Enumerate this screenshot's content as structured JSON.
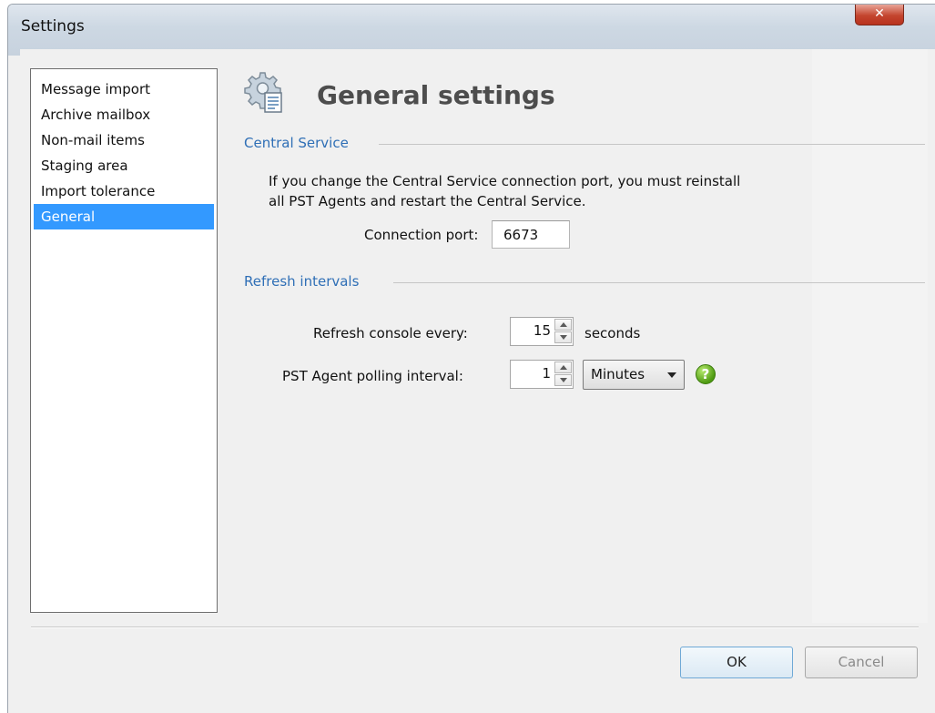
{
  "window": {
    "title": "Settings",
    "close_glyph": "✕"
  },
  "nav": {
    "items": [
      {
        "label": "Message import"
      },
      {
        "label": "Archive mailbox"
      },
      {
        "label": "Non-mail items"
      },
      {
        "label": "Staging area"
      },
      {
        "label": "Import tolerance"
      },
      {
        "label": "General",
        "selected": true
      }
    ]
  },
  "header": {
    "title": "General settings",
    "icon": "gear-settings-icon"
  },
  "central_service": {
    "heading": "Central Service",
    "note_line1": "If you change the Central Service connection port, you must reinstall",
    "note_line2": "all PST Agents and restart the Central Service.",
    "port_label": "Connection port:",
    "port_value": "6673"
  },
  "refresh": {
    "heading": "Refresh intervals",
    "console_label": "Refresh console every:",
    "console_value": "15",
    "console_unit": "seconds",
    "agent_label": "PST Agent polling interval:",
    "agent_value": "1",
    "agent_unit": "Minutes",
    "help_glyph": "?"
  },
  "buttons": {
    "ok": "OK",
    "cancel": "Cancel"
  },
  "colors": {
    "accent": "#3399ff",
    "section_heading": "#2f6fb6",
    "help": "#4f9b12"
  }
}
